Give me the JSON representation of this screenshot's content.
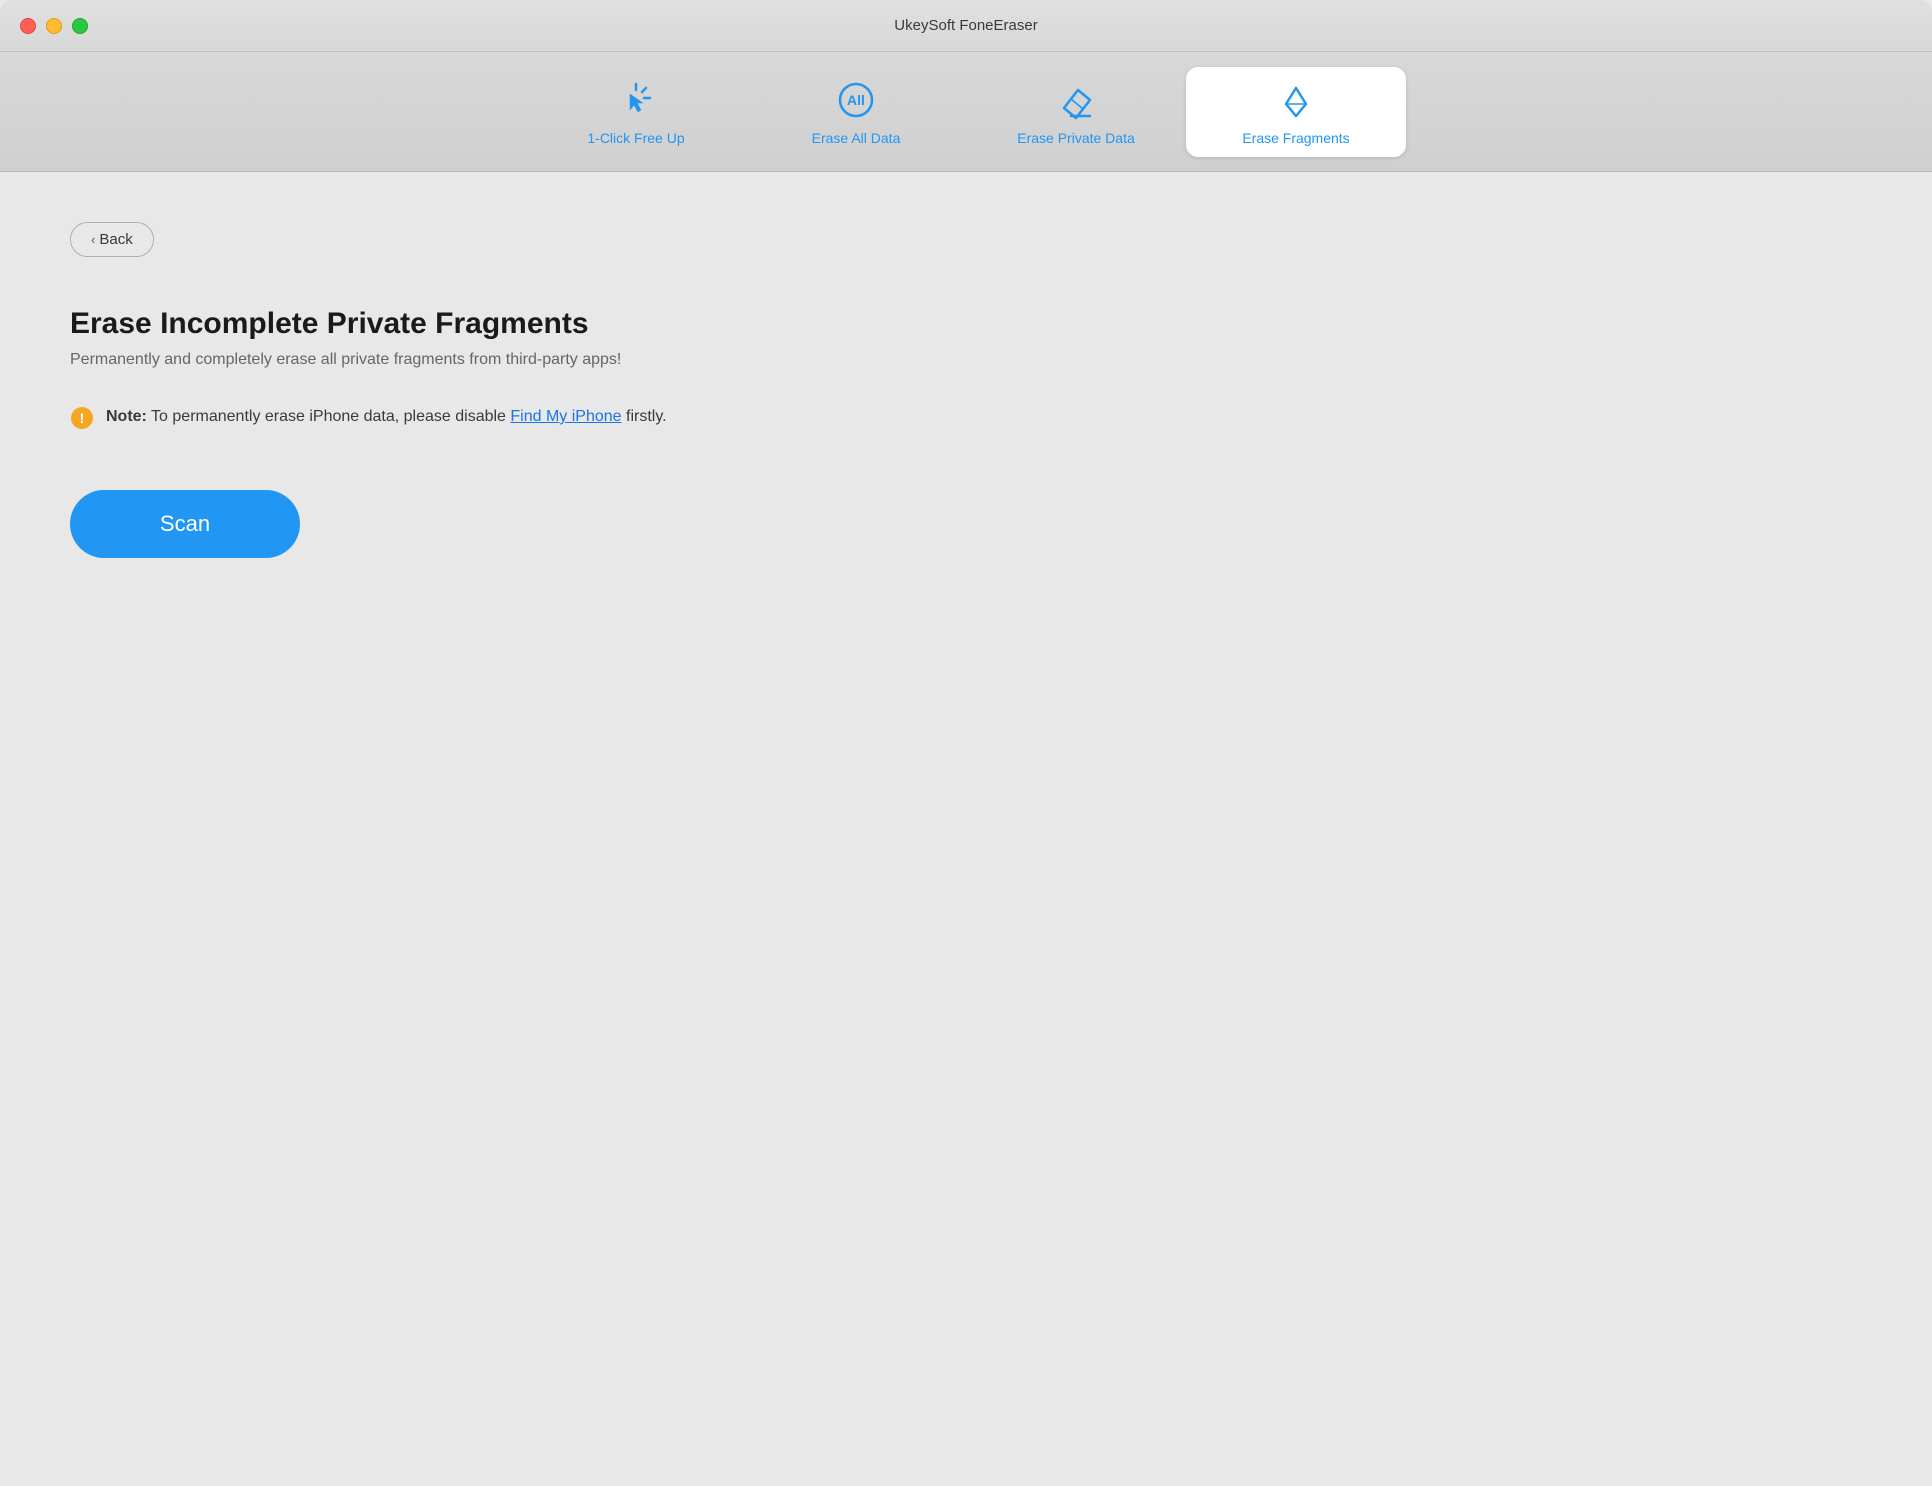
{
  "window": {
    "title": "UkeySoft FoneEraser"
  },
  "traffic_lights": {
    "close_label": "close",
    "minimize_label": "minimize",
    "maximize_label": "maximize"
  },
  "toolbar": {
    "tabs": [
      {
        "id": "one-click-free-up",
        "label": "1-Click Free Up",
        "icon": "cursor-click-icon",
        "active": false
      },
      {
        "id": "erase-all-data",
        "label": "Erase All Data",
        "icon": "erase-all-icon",
        "active": false
      },
      {
        "id": "erase-private-data",
        "label": "Erase Private Data",
        "icon": "erase-private-icon",
        "active": false
      },
      {
        "id": "erase-fragments",
        "label": "Erase Fragments",
        "icon": "erase-fragments-icon",
        "active": true
      }
    ]
  },
  "main": {
    "back_button_label": "Back",
    "section_title": "Erase Incomplete Private Fragments",
    "section_subtitle": "Permanently and completely erase all private fragments from third-party apps!",
    "note_prefix": "Note:",
    "note_text": " To permanently erase iPhone data, please disable ",
    "note_link": "Find My iPhone",
    "note_suffix": " firstly.",
    "scan_button_label": "Scan"
  }
}
